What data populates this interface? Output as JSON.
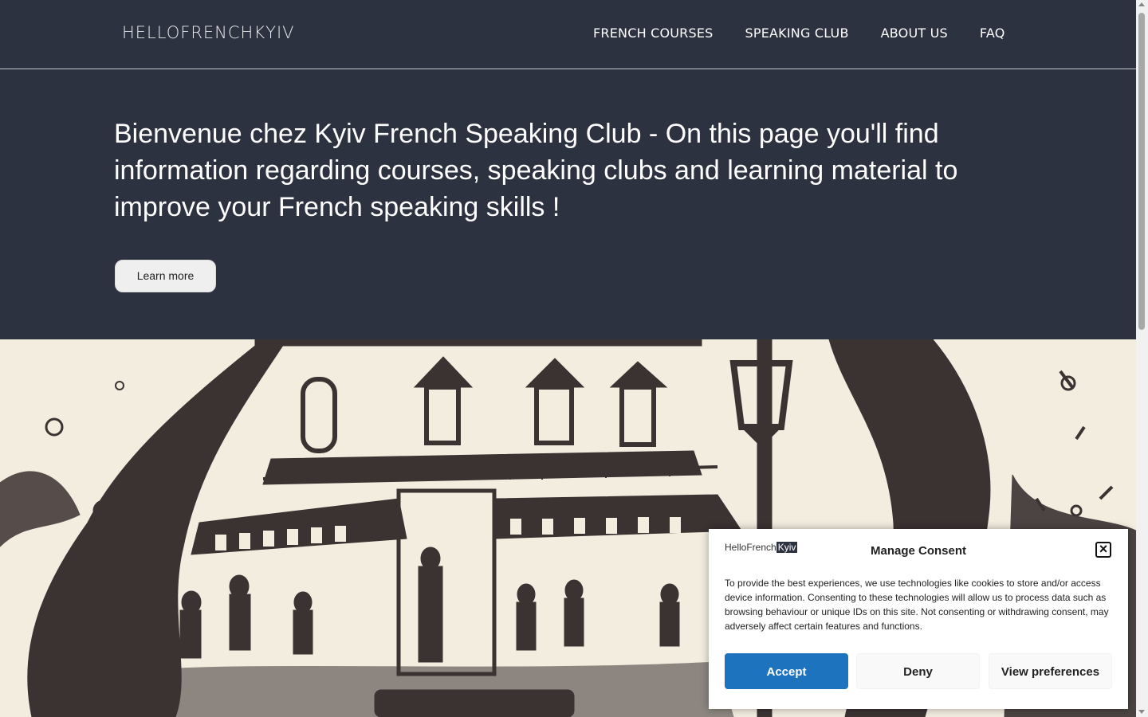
{
  "header": {
    "site_title": "HELLOFRENCHKYIV",
    "nav": [
      "FRENCH COURSES",
      "SPEAKING CLUB",
      "ABOUT US",
      "FAQ"
    ]
  },
  "hero": {
    "heading": "Bienvenue chez Kyiv French Speaking Club - On this page you'll find information regarding courses, speaking clubs and learning material to improve your French speaking skills !",
    "button_label": "Learn more"
  },
  "illustration": {
    "icon": "parisian-cafe-sketch"
  },
  "consent": {
    "logo_text": "HelloFrench",
    "logo_highlight": "Kyiv",
    "title": "Manage Consent",
    "close_icon": "close-icon",
    "text": "To provide the best experiences, we use technologies like cookies to store and/or access device information. Consenting to these technologies will allow us to process data such as browsing behaviour or unique IDs on this site. Not consenting or withdrawing consent, may adversely affect certain features and functions.",
    "accept_label": "Accept",
    "deny_label": "Deny",
    "preferences_label": "View preferences"
  },
  "colors": {
    "header_bg": "#2d3241",
    "illustration_bg": "#f3ede0",
    "sketch_ink": "#3b3232",
    "accept_bg": "#1e73be"
  }
}
